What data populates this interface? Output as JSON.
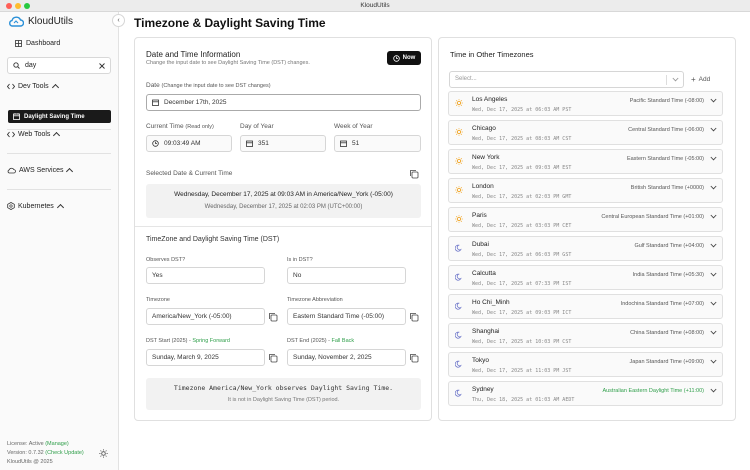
{
  "window": {
    "title": "KloudUtils"
  },
  "sidebar": {
    "app_name": "KloudUtils",
    "dashboard": "Dashboard",
    "search_value": "day",
    "groups": {
      "dev_tools": "Dev Tools",
      "active_item": "Daylight Saving Time",
      "web_tools": "Web Tools",
      "aws_services": "AWS Services",
      "kubernetes": "Kubernetes"
    },
    "footer": {
      "license": "License: Active",
      "manage": "(Manage)",
      "version": "Version: 0.7.32",
      "check_update": "(Check Update)",
      "copyright": "KloudUtils @ 2025"
    }
  },
  "main": {
    "title": "Timezone & Daylight Saving Time",
    "info": {
      "heading": "Date and Time Information",
      "subtext": "Change the input date to see Daylight Saving Time (DST) changes.",
      "now_button": "Now",
      "date_label": "Date",
      "date_hint": "(Change the input date to see DST changes)",
      "date_value": "December 17th, 2025",
      "current_time_label": "Current Time",
      "current_time_hint": "(Read only)",
      "current_time_value": "09:03:49 AM",
      "day_of_year_label": "Day of Year",
      "day_of_year_value": "351",
      "week_of_year_label": "Week of Year",
      "week_of_year_value": "51",
      "selected_label": "Selected Date & Current Time",
      "selected_line1": "Wednesday, December 17, 2025 at 09:03 AM in America/New_York (-05:00)",
      "selected_line2": "Wednesday, December 17, 2025 at 02:03 PM (UTC+00:00)"
    },
    "dst": {
      "heading": "TimeZone and Daylight Saving Time (DST)",
      "observes_label": "Observes DST?",
      "observes_value": "Yes",
      "is_in_label": "Is in DST?",
      "is_in_value": "No",
      "timezone_label": "Timezone",
      "timezone_value": "America/New_York (-05:00)",
      "abbrev_label": "Timezone Abbreviation",
      "abbrev_value": "Eastern Standard Time (-05:00)",
      "start_label": "DST Start (2025) -",
      "start_tag": "Spring Forward",
      "start_value": "Sunday, March 9, 2025",
      "end_label": "DST End (2025) -",
      "end_tag": "Fall Back",
      "end_value": "Sunday, November 2, 2025",
      "summary1": "Timezone America/New_York observes Daylight Saving Time.",
      "summary2": "It is not in Daylight Saving Time (DST) period."
    }
  },
  "other": {
    "heading": "Time in Other Timezones",
    "select_placeholder": "Select...",
    "add_label": "Add",
    "zones": [
      {
        "city": "Los Angeles",
        "time": "Wed, Dec 17, 2025 at 06:03 AM PST",
        "std": "Pacific Standard Time (-08:00)",
        "icon": "sun-icon"
      },
      {
        "city": "Chicago",
        "time": "Wed, Dec 17, 2025 at 08:03 AM CST",
        "std": "Central Standard Time (-06:00)",
        "icon": "sun-icon"
      },
      {
        "city": "New York",
        "time": "Wed, Dec 17, 2025 at 09:03 AM EST",
        "std": "Eastern Standard Time (-05:00)",
        "icon": "sun-icon"
      },
      {
        "city": "London",
        "time": "Wed, Dec 17, 2025 at 02:03 PM GMT",
        "std": "British Standard Time (+0000)",
        "icon": "sun-icon"
      },
      {
        "city": "Paris",
        "time": "Wed, Dec 17, 2025 at 03:03 PM CET",
        "std": "Central European Standard Time (+01:00)",
        "icon": "sun-icon"
      },
      {
        "city": "Dubai",
        "time": "Wed, Dec 17, 2025 at 06:03 PM GST",
        "std": "Gulf Standard Time (+04:00)",
        "icon": "moon-icon"
      },
      {
        "city": "Calcutta",
        "time": "Wed, Dec 17, 2025 at 07:33 PM IST",
        "std": "India Standard Time (+05:30)",
        "icon": "moon-icon"
      },
      {
        "city": "Ho Chi_Minh",
        "time": "Wed, Dec 17, 2025 at 09:03 PM ICT",
        "std": "Indochina Standard Time (+07:00)",
        "icon": "moon-icon"
      },
      {
        "city": "Shanghai",
        "time": "Wed, Dec 17, 2025 at 10:03 PM CST",
        "std": "China Standard Time (+08:00)",
        "icon": "moon-icon"
      },
      {
        "city": "Tokyo",
        "time": "Wed, Dec 17, 2025 at 11:03 PM JST",
        "std": "Japan Standard Time (+09:00)",
        "icon": "moon-icon"
      },
      {
        "city": "Sydney",
        "time": "Thu, Dec 18, 2025 at 01:03 AM AEDT",
        "std": "Australian Eastern Daylight Time (+11:00)",
        "icon": "moon-icon",
        "std_green": true
      }
    ]
  },
  "colors": {
    "accent_green": "#2e9e49",
    "active_bg": "#1a1a1a",
    "sun": "#f0a11a",
    "moon": "#6b74c9"
  }
}
